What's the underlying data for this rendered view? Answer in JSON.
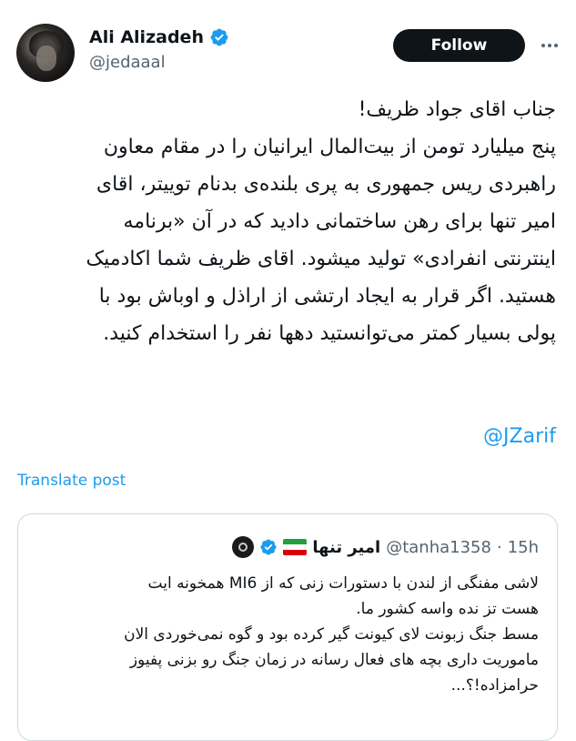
{
  "author": {
    "name": "Ali Alizadeh",
    "handle": "@jedaaal",
    "verified_color": "#1d9bf0"
  },
  "follow_label": "Follow",
  "more_icon": "more-horizontal-icon",
  "tweet": {
    "lines": [
      "جناب اقای جواد ظریف!",
      "پنج میلیارد تومن از بیت‌المال ایرانیان را در مقام معاون",
      "راهبردی ریس جمهوری به پری بلنده‌ی بدنام توییتر، اقای",
      "امیر تنها برای رهن ساختمانی دادید که در آن «برنامه",
      "اینترنتی انفرادی» تولید میشود. اقای ظریف شما اکادمیک",
      "هستید. اگر قرار به ایجاد ارتشی از اراذل و اوباش بود با",
      "پولی بسیار کمتر می‌توانستید دهها نفر را استخدام کنید."
    ],
    "mention": "@JZarif"
  },
  "translate_label": "Translate post",
  "quoted": {
    "name": "امیر تنها",
    "flag": "iran-flag",
    "handle": "@tanha1358",
    "separator": "·",
    "time": "15h",
    "lines": [
      "لاشی مفنگی از لندن با دستورات زنی که از MI6 همخونه ایت",
      "هست تز نده واسه کشور ما.",
      "مسط جنگ زبونت لای کیونت گیر کرده بود و گوه نمی‌خوردی الان",
      "ماموریت داری بچه های فعال رسانه در زمان جنگ رو بزنی پفیوز",
      "حرامزاده!؟..."
    ]
  },
  "colors": {
    "accent": "#1d9bf0",
    "text": "#0f1419",
    "muted": "#536471",
    "border": "#cfd9de"
  }
}
